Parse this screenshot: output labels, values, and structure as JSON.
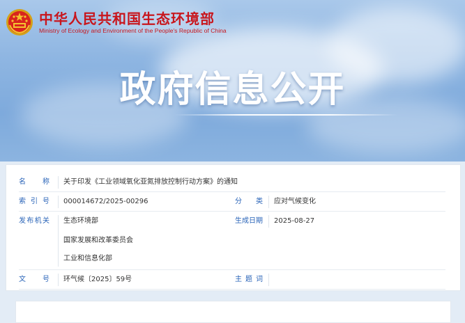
{
  "header": {
    "ministry_cn": "中华人民共和国生态环境部",
    "ministry_en": "Ministry of Ecology and Environment of the People's Republic of China",
    "emblem_icon": "national-emblem-icon",
    "banner_title": "政府信息公开"
  },
  "meta": {
    "name_label": "名　称",
    "name_value": "关于印发《工业领域氧化亚氮排放控制行动方案》的通知",
    "index_label": "索 引 号",
    "index_value": "000014672/2025-00296",
    "category_label": "分　类",
    "category_value": "应对气候变化",
    "issuer_label": "发布机关",
    "issuers": [
      "生态环境部",
      "国家发展和改革委员会",
      "工业和信息化部"
    ],
    "date_label": "生成日期",
    "date_value": "2025-08-27",
    "doc_no_label": "文　号",
    "doc_no_value": "环气候〔2025〕59号",
    "keywords_label": "主 题 词",
    "keywords_value": ""
  },
  "colors": {
    "brand_red": "#c8161d",
    "label_blue": "#2a64b8",
    "sky": "#8fb6e2"
  }
}
